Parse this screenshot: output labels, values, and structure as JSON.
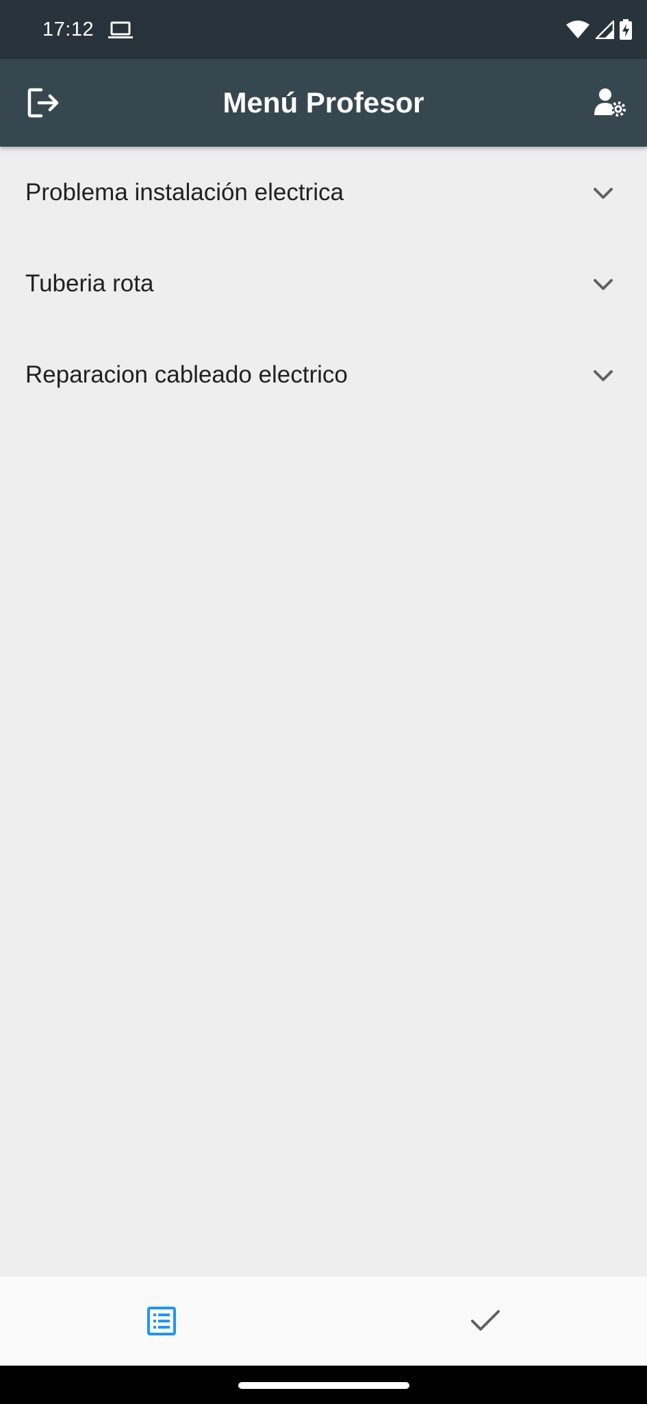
{
  "status_bar": {
    "time": "17:12",
    "icons": [
      "laptop-icon",
      "wifi-icon",
      "signal-icon",
      "battery-charging-icon"
    ]
  },
  "app_bar": {
    "title": "Menú Profesor",
    "left_icon": "logout-icon",
    "right_icon": "user-settings-icon"
  },
  "list": {
    "items": [
      {
        "label": "Problema instalación electrica",
        "icon": "chevron-down-icon"
      },
      {
        "label": "Tuberia rota",
        "icon": "chevron-down-icon"
      },
      {
        "label": "Reparacion cableado electrico",
        "icon": "chevron-down-icon"
      }
    ]
  },
  "bottom_nav": {
    "items": [
      {
        "icon": "list-icon",
        "selected": true
      },
      {
        "icon": "check-icon",
        "selected": false
      }
    ]
  },
  "colors": {
    "status_bar": "#29333b",
    "app_bar": "#37474f",
    "background": "#eeeeee",
    "text": "#212121",
    "accent": "#2196f3",
    "icon_inactive": "#616161",
    "bottom_nav": "#fafafa"
  }
}
